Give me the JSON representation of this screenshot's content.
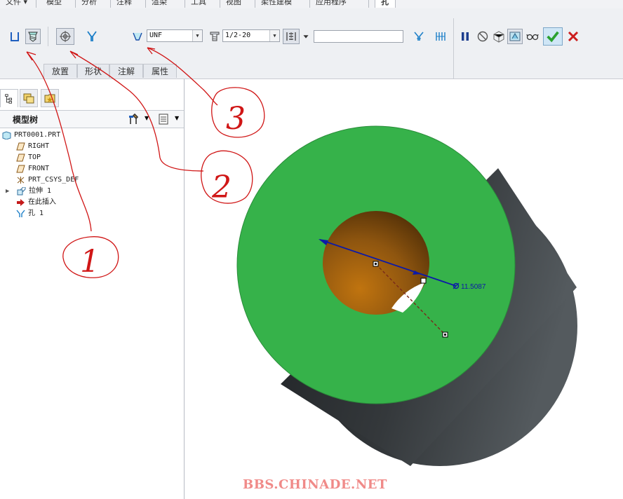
{
  "menu": {
    "tabs": [
      "文件 ▾",
      "模型",
      "分析",
      "注释",
      "渲染",
      "工具",
      "视图",
      "柔性建模",
      "应用程序",
      "孔"
    ]
  },
  "ribbon": {
    "thread_standard": "UNF",
    "screw_size": "1/2-20",
    "depth_value": "",
    "subtabs": [
      "放置",
      "形状",
      "注解",
      "属性"
    ]
  },
  "model_tree": {
    "title": "模型树",
    "items": [
      "PRT0001.PRT",
      "RIGHT",
      "TOP",
      "FRONT",
      "PRT_CSYS_DEF",
      "拉伸 1",
      "在此插入",
      "孔 1"
    ]
  },
  "viewport": {
    "dimension_label": "11.5087"
  },
  "annotations": [
    "1",
    "2",
    "3"
  ],
  "watermark": "BBS.CHINADE.NET",
  "colors": {
    "face_green": "#36b24a",
    "cylinder_dark": "#3a3d40",
    "hole_brown": "#8a5410",
    "dimension_blue": "#0c1aa8",
    "ok_green": "#2aa12f",
    "cancel_red": "#cc1e1e",
    "annotation_red": "#d01616"
  }
}
